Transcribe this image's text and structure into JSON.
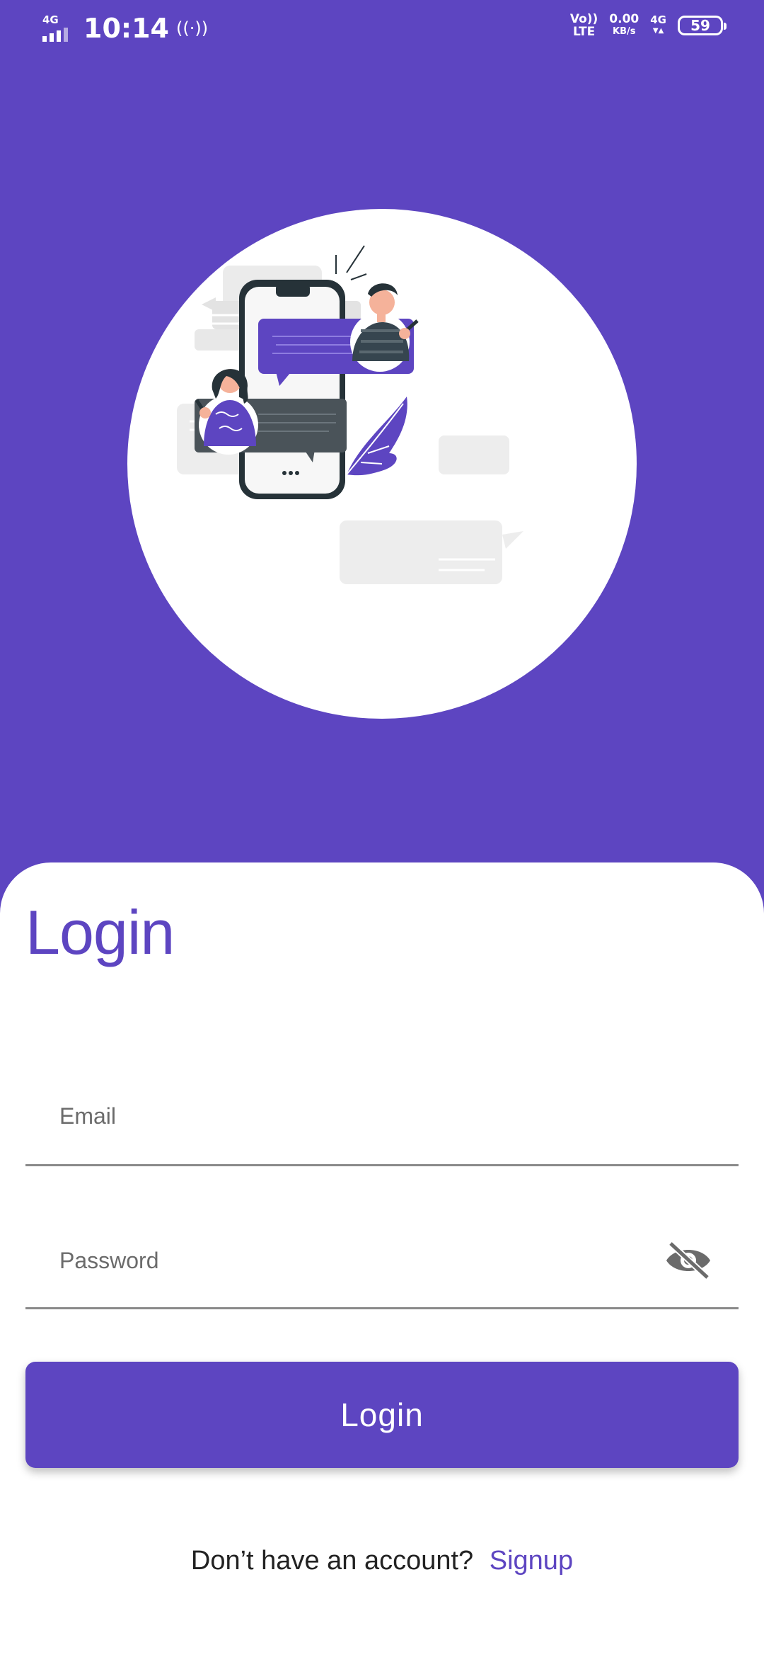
{
  "status_bar": {
    "network_type": "4G",
    "time": "10:14",
    "hotspot_symbol": "((·))",
    "volte_top": "Vo))",
    "volte_bottom": "LTE",
    "speed_value": "0.00",
    "speed_unit": "KB/s",
    "data_type": "4G",
    "data_arrows": "▼▲",
    "battery_level": "59"
  },
  "login": {
    "title": "Login",
    "email_placeholder": "Email",
    "password_placeholder": "Password",
    "button_label": "Login",
    "signup_prompt": "Don’t have an account?",
    "signup_link": "Signup"
  },
  "colors": {
    "primary": "#5D45C1",
    "background_sheet": "#FFFFFF",
    "divider": "#8A8A8A",
    "chat_dark": "#4A5359"
  },
  "icons": {
    "password_toggle": "eye-off-icon",
    "hotspot": "hotspot-icon",
    "battery": "battery-icon"
  }
}
